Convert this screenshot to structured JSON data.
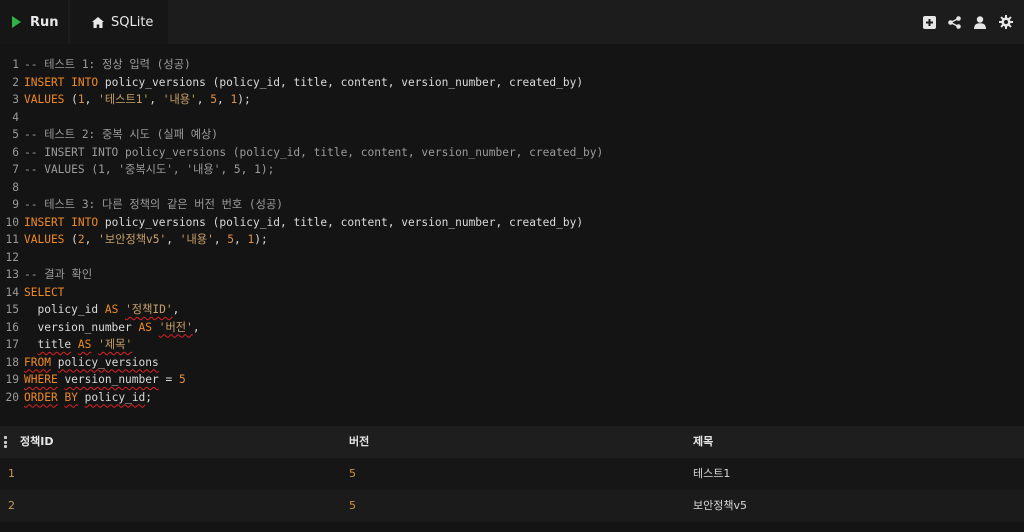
{
  "toolbar": {
    "run_label": "Run",
    "db_label": "SQLite",
    "icons": [
      "add-square-icon",
      "share-icon",
      "user-icon",
      "gear-icon"
    ]
  },
  "editor": {
    "lines": [
      {
        "n": "1",
        "tokens": [
          {
            "t": "-- 테스트 1: 정상 입력 (성공)",
            "c": "cm"
          }
        ]
      },
      {
        "n": "2",
        "tokens": [
          {
            "t": "INSERT",
            "c": "kw"
          },
          {
            "t": " ",
            "c": "id"
          },
          {
            "t": "INTO",
            "c": "kw"
          },
          {
            "t": " policy_versions (policy_id, title, content, version_number, created_by)",
            "c": "id"
          }
        ]
      },
      {
        "n": "3",
        "tokens": [
          {
            "t": "VALUES",
            "c": "kw"
          },
          {
            "t": " (",
            "c": "id"
          },
          {
            "t": "1",
            "c": "num"
          },
          {
            "t": ", ",
            "c": "id"
          },
          {
            "t": "'테스트1'",
            "c": "str"
          },
          {
            "t": ", ",
            "c": "id"
          },
          {
            "t": "'내용'",
            "c": "str"
          },
          {
            "t": ", ",
            "c": "id"
          },
          {
            "t": "5",
            "c": "num"
          },
          {
            "t": ", ",
            "c": "id"
          },
          {
            "t": "1",
            "c": "num"
          },
          {
            "t": ");",
            "c": "id"
          }
        ]
      },
      {
        "n": "4",
        "tokens": []
      },
      {
        "n": "5",
        "tokens": [
          {
            "t": "-- 테스트 2: 중복 시도 (실패 예상)",
            "c": "cm"
          }
        ]
      },
      {
        "n": "6",
        "tokens": [
          {
            "t": "-- INSERT INTO policy_versions (policy_id, title, content, version_number, created_by)",
            "c": "cm"
          }
        ]
      },
      {
        "n": "7",
        "tokens": [
          {
            "t": "-- VALUES (1, '중복시도', '내용', 5, 1);",
            "c": "cm"
          }
        ]
      },
      {
        "n": "8",
        "tokens": []
      },
      {
        "n": "9",
        "tokens": [
          {
            "t": "-- 테스트 3: 다른 정책의 같은 버전 번호 (성공)",
            "c": "cm"
          }
        ]
      },
      {
        "n": "10",
        "tokens": [
          {
            "t": "INSERT",
            "c": "kw"
          },
          {
            "t": " ",
            "c": "id"
          },
          {
            "t": "INTO",
            "c": "kw"
          },
          {
            "t": " policy_versions (policy_id, title, content, version_number, created_by)",
            "c": "id"
          }
        ]
      },
      {
        "n": "11",
        "tokens": [
          {
            "t": "VALUES",
            "c": "kw"
          },
          {
            "t": " (",
            "c": "id"
          },
          {
            "t": "2",
            "c": "num"
          },
          {
            "t": ", ",
            "c": "id"
          },
          {
            "t": "'보안정책v5'",
            "c": "str"
          },
          {
            "t": ", ",
            "c": "id"
          },
          {
            "t": "'내용'",
            "c": "str"
          },
          {
            "t": ", ",
            "c": "id"
          },
          {
            "t": "5",
            "c": "num"
          },
          {
            "t": ", ",
            "c": "id"
          },
          {
            "t": "1",
            "c": "num"
          },
          {
            "t": ");",
            "c": "id"
          }
        ]
      },
      {
        "n": "12",
        "tokens": []
      },
      {
        "n": "13",
        "tokens": [
          {
            "t": "-- 결과 확인",
            "c": "cm"
          }
        ]
      },
      {
        "n": "14",
        "tokens": [
          {
            "t": "SELECT",
            "c": "kw"
          }
        ]
      },
      {
        "n": "15",
        "tokens": [
          {
            "t": "  policy_id ",
            "c": "id"
          },
          {
            "t": "AS",
            "c": "kw"
          },
          {
            "t": " ",
            "c": "id"
          },
          {
            "t": "'정책ID'",
            "c": "str sq"
          },
          {
            "t": ",",
            "c": "id"
          }
        ]
      },
      {
        "n": "16",
        "tokens": [
          {
            "t": "  version_number ",
            "c": "id"
          },
          {
            "t": "AS",
            "c": "kw"
          },
          {
            "t": " ",
            "c": "id"
          },
          {
            "t": "'버전'",
            "c": "str sq"
          },
          {
            "t": ",",
            "c": "id"
          }
        ]
      },
      {
        "n": "17",
        "tokens": [
          {
            "t": "  ",
            "c": "id"
          },
          {
            "t": "title",
            "c": "id sq"
          },
          {
            "t": " ",
            "c": "id"
          },
          {
            "t": "AS",
            "c": "kw sq"
          },
          {
            "t": " ",
            "c": "id"
          },
          {
            "t": "'제목'",
            "c": "str sq"
          }
        ]
      },
      {
        "n": "18",
        "tokens": [
          {
            "t": "FROM",
            "c": "kw sq"
          },
          {
            "t": " ",
            "c": "id"
          },
          {
            "t": "policy_versions",
            "c": "id sq"
          }
        ]
      },
      {
        "n": "19",
        "tokens": [
          {
            "t": "WHERE",
            "c": "kw sq"
          },
          {
            "t": " ",
            "c": "id"
          },
          {
            "t": "version_number",
            "c": "id sq"
          },
          {
            "t": " = ",
            "c": "id"
          },
          {
            "t": "5",
            "c": "num"
          }
        ]
      },
      {
        "n": "20",
        "tokens": [
          {
            "t": "ORDER",
            "c": "kw sq"
          },
          {
            "t": " ",
            "c": "id"
          },
          {
            "t": "BY",
            "c": "kw sq"
          },
          {
            "t": " ",
            "c": "id"
          },
          {
            "t": "policy_id",
            "c": "id sq"
          },
          {
            "t": ";",
            "c": "id"
          }
        ]
      }
    ]
  },
  "results": {
    "columns": [
      "정책ID",
      "버전",
      "제목"
    ],
    "rows": [
      {
        "index": "1",
        "id": "",
        "version": "5",
        "title": "테스트1"
      },
      {
        "index": "2",
        "id": "",
        "version": "5",
        "title": "보안정책v5"
      }
    ]
  }
}
